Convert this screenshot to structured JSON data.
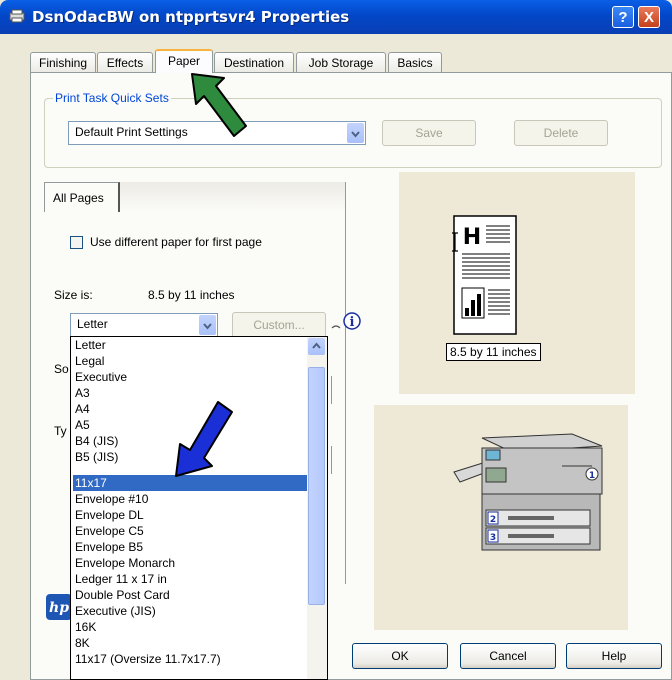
{
  "window": {
    "title": "DsnOdacBW on ntpprtsvr4 Properties",
    "help_glyph": "?",
    "close_glyph": "X"
  },
  "tabs": [
    {
      "label": "Finishing"
    },
    {
      "label": "Effects"
    },
    {
      "label": "Paper"
    },
    {
      "label": "Destination"
    },
    {
      "label": "Job Storage"
    },
    {
      "label": "Basics"
    }
  ],
  "quick_sets": {
    "legend": "Print Task Quick Sets",
    "selected": "Default Print Settings",
    "save_label": "Save",
    "delete_label": "Delete"
  },
  "paper": {
    "inner_tab": "All Pages",
    "use_different_paper_label": "Use different paper for first page",
    "size_label": "Size is:",
    "size_value": "8.5 by 11 inches",
    "size_selected": "Letter",
    "custom_label": "Custom...",
    "source_partial": "So",
    "type_partial": "Ty",
    "options": [
      "Letter",
      "Legal",
      "Executive",
      "A3",
      "A4",
      "A5",
      "B4 (JIS)",
      "B5 (JIS)",
      "11x17",
      "Envelope #10",
      "Envelope DL",
      "Envelope C5",
      "Envelope B5",
      "Envelope Monarch",
      "Ledger 11 x 17 in",
      "Double Post Card",
      "Executive (JIS)",
      "16K",
      "8K",
      "11x17 (Oversize 11.7x17.7)"
    ],
    "highlighted_index": 8
  },
  "preview": {
    "page_letter": "H",
    "size_caption": "8.5 by 11 inches",
    "tray_labels": [
      "1",
      "2",
      "3"
    ]
  },
  "footer": {
    "ok_label": "OK",
    "cancel_label": "Cancel",
    "help_label": "Help"
  },
  "colors": {
    "title_bar": "#0247c8",
    "selection": "#316ac5",
    "green_arrow": "#2e8b3e",
    "blue_arrow": "#1a2fd6"
  }
}
